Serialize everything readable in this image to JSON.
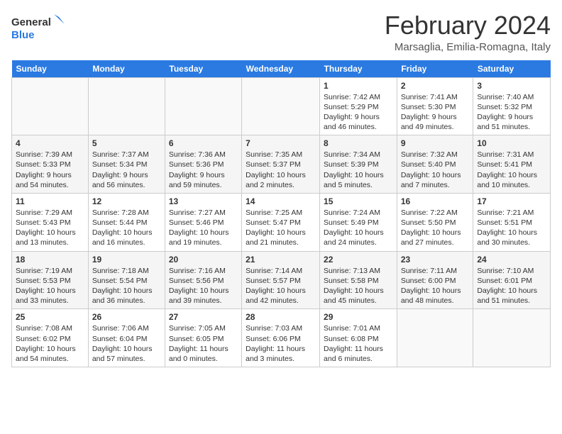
{
  "header": {
    "logo_general": "General",
    "logo_blue": "Blue",
    "month": "February 2024",
    "location": "Marsaglia, Emilia-Romagna, Italy"
  },
  "weekdays": [
    "Sunday",
    "Monday",
    "Tuesday",
    "Wednesday",
    "Thursday",
    "Friday",
    "Saturday"
  ],
  "weeks": [
    [
      {
        "day": "",
        "sunrise": "",
        "sunset": "",
        "daylight": ""
      },
      {
        "day": "",
        "sunrise": "",
        "sunset": "",
        "daylight": ""
      },
      {
        "day": "",
        "sunrise": "",
        "sunset": "",
        "daylight": ""
      },
      {
        "day": "",
        "sunrise": "",
        "sunset": "",
        "daylight": ""
      },
      {
        "day": "1",
        "sunrise": "Sunrise: 7:42 AM",
        "sunset": "Sunset: 5:29 PM",
        "daylight": "Daylight: 9 hours and 46 minutes."
      },
      {
        "day": "2",
        "sunrise": "Sunrise: 7:41 AM",
        "sunset": "Sunset: 5:30 PM",
        "daylight": "Daylight: 9 hours and 49 minutes."
      },
      {
        "day": "3",
        "sunrise": "Sunrise: 7:40 AM",
        "sunset": "Sunset: 5:32 PM",
        "daylight": "Daylight: 9 hours and 51 minutes."
      }
    ],
    [
      {
        "day": "4",
        "sunrise": "Sunrise: 7:39 AM",
        "sunset": "Sunset: 5:33 PM",
        "daylight": "Daylight: 9 hours and 54 minutes."
      },
      {
        "day": "5",
        "sunrise": "Sunrise: 7:37 AM",
        "sunset": "Sunset: 5:34 PM",
        "daylight": "Daylight: 9 hours and 56 minutes."
      },
      {
        "day": "6",
        "sunrise": "Sunrise: 7:36 AM",
        "sunset": "Sunset: 5:36 PM",
        "daylight": "Daylight: 9 hours and 59 minutes."
      },
      {
        "day": "7",
        "sunrise": "Sunrise: 7:35 AM",
        "sunset": "Sunset: 5:37 PM",
        "daylight": "Daylight: 10 hours and 2 minutes."
      },
      {
        "day": "8",
        "sunrise": "Sunrise: 7:34 AM",
        "sunset": "Sunset: 5:39 PM",
        "daylight": "Daylight: 10 hours and 5 minutes."
      },
      {
        "day": "9",
        "sunrise": "Sunrise: 7:32 AM",
        "sunset": "Sunset: 5:40 PM",
        "daylight": "Daylight: 10 hours and 7 minutes."
      },
      {
        "day": "10",
        "sunrise": "Sunrise: 7:31 AM",
        "sunset": "Sunset: 5:41 PM",
        "daylight": "Daylight: 10 hours and 10 minutes."
      }
    ],
    [
      {
        "day": "11",
        "sunrise": "Sunrise: 7:29 AM",
        "sunset": "Sunset: 5:43 PM",
        "daylight": "Daylight: 10 hours and 13 minutes."
      },
      {
        "day": "12",
        "sunrise": "Sunrise: 7:28 AM",
        "sunset": "Sunset: 5:44 PM",
        "daylight": "Daylight: 10 hours and 16 minutes."
      },
      {
        "day": "13",
        "sunrise": "Sunrise: 7:27 AM",
        "sunset": "Sunset: 5:46 PM",
        "daylight": "Daylight: 10 hours and 19 minutes."
      },
      {
        "day": "14",
        "sunrise": "Sunrise: 7:25 AM",
        "sunset": "Sunset: 5:47 PM",
        "daylight": "Daylight: 10 hours and 21 minutes."
      },
      {
        "day": "15",
        "sunrise": "Sunrise: 7:24 AM",
        "sunset": "Sunset: 5:49 PM",
        "daylight": "Daylight: 10 hours and 24 minutes."
      },
      {
        "day": "16",
        "sunrise": "Sunrise: 7:22 AM",
        "sunset": "Sunset: 5:50 PM",
        "daylight": "Daylight: 10 hours and 27 minutes."
      },
      {
        "day": "17",
        "sunrise": "Sunrise: 7:21 AM",
        "sunset": "Sunset: 5:51 PM",
        "daylight": "Daylight: 10 hours and 30 minutes."
      }
    ],
    [
      {
        "day": "18",
        "sunrise": "Sunrise: 7:19 AM",
        "sunset": "Sunset: 5:53 PM",
        "daylight": "Daylight: 10 hours and 33 minutes."
      },
      {
        "day": "19",
        "sunrise": "Sunrise: 7:18 AM",
        "sunset": "Sunset: 5:54 PM",
        "daylight": "Daylight: 10 hours and 36 minutes."
      },
      {
        "day": "20",
        "sunrise": "Sunrise: 7:16 AM",
        "sunset": "Sunset: 5:56 PM",
        "daylight": "Daylight: 10 hours and 39 minutes."
      },
      {
        "day": "21",
        "sunrise": "Sunrise: 7:14 AM",
        "sunset": "Sunset: 5:57 PM",
        "daylight": "Daylight: 10 hours and 42 minutes."
      },
      {
        "day": "22",
        "sunrise": "Sunrise: 7:13 AM",
        "sunset": "Sunset: 5:58 PM",
        "daylight": "Daylight: 10 hours and 45 minutes."
      },
      {
        "day": "23",
        "sunrise": "Sunrise: 7:11 AM",
        "sunset": "Sunset: 6:00 PM",
        "daylight": "Daylight: 10 hours and 48 minutes."
      },
      {
        "day": "24",
        "sunrise": "Sunrise: 7:10 AM",
        "sunset": "Sunset: 6:01 PM",
        "daylight": "Daylight: 10 hours and 51 minutes."
      }
    ],
    [
      {
        "day": "25",
        "sunrise": "Sunrise: 7:08 AM",
        "sunset": "Sunset: 6:02 PM",
        "daylight": "Daylight: 10 hours and 54 minutes."
      },
      {
        "day": "26",
        "sunrise": "Sunrise: 7:06 AM",
        "sunset": "Sunset: 6:04 PM",
        "daylight": "Daylight: 10 hours and 57 minutes."
      },
      {
        "day": "27",
        "sunrise": "Sunrise: 7:05 AM",
        "sunset": "Sunset: 6:05 PM",
        "daylight": "Daylight: 11 hours and 0 minutes."
      },
      {
        "day": "28",
        "sunrise": "Sunrise: 7:03 AM",
        "sunset": "Sunset: 6:06 PM",
        "daylight": "Daylight: 11 hours and 3 minutes."
      },
      {
        "day": "29",
        "sunrise": "Sunrise: 7:01 AM",
        "sunset": "Sunset: 6:08 PM",
        "daylight": "Daylight: 11 hours and 6 minutes."
      },
      {
        "day": "",
        "sunrise": "",
        "sunset": "",
        "daylight": ""
      },
      {
        "day": "",
        "sunrise": "",
        "sunset": "",
        "daylight": ""
      }
    ]
  ]
}
